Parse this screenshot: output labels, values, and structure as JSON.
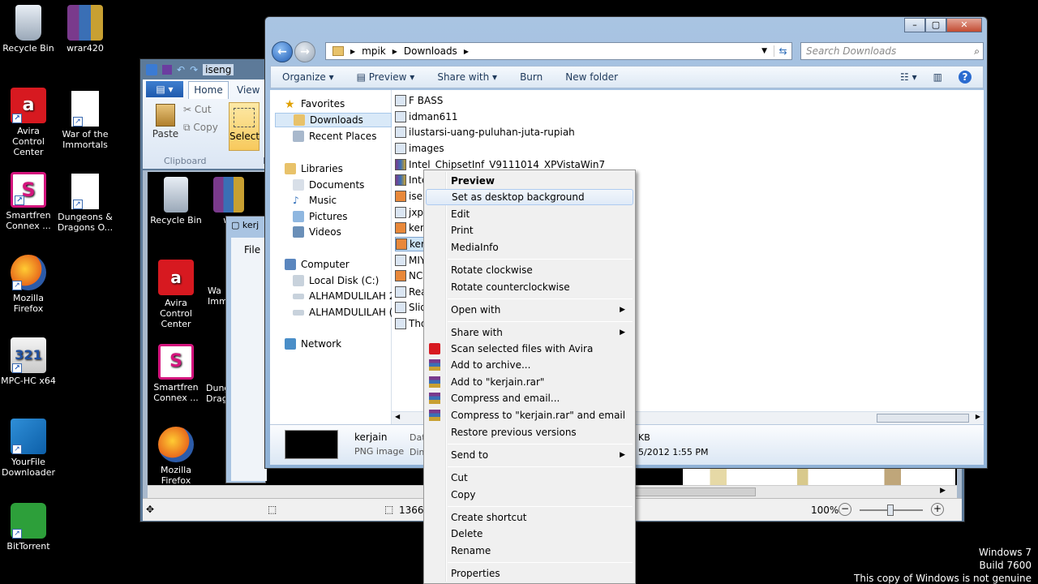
{
  "desktop": {
    "icons": [
      {
        "label": "Recycle Bin"
      },
      {
        "label": "wrar420"
      },
      {
        "label": "Avira Control Center"
      },
      {
        "label": "War of the Immortals"
      },
      {
        "label": "Smartfren Connex ..."
      },
      {
        "label": "Dungeons & Dragons O..."
      },
      {
        "label": "Mozilla Firefox"
      },
      {
        "label": "MPC-HC x64"
      },
      {
        "label": "YourFile Downloader"
      },
      {
        "label": "BitTorrent"
      }
    ],
    "watermark": {
      "line1": "Windows 7",
      "line2": "Build 7600",
      "line3": "This copy of Windows is not genuine"
    }
  },
  "paint_window": {
    "title": "iseng",
    "tabs": {
      "home": "Home",
      "view": "View"
    },
    "clipboard": {
      "paste": "Paste",
      "cut": "Cut",
      "copy": "Copy",
      "group": "Clipboard"
    },
    "select": "Select",
    "canvas_icons": {
      "recycle": "Recycle Bin",
      "wrar": "wr",
      "avira": "Avira Control Center",
      "war": "Wa Imm",
      "smartfren": "Smartfren Connex ...",
      "dungeons": "Dung Drag",
      "firefox": "Mozilla Firefox"
    },
    "inner_title": "kerj",
    "inner_file": "File",
    "status": {
      "size": "1366 ×",
      "zoom": "100%"
    }
  },
  "explorer": {
    "breadcrumb": [
      "mpik",
      "Downloads"
    ],
    "search_placeholder": "Search Downloads",
    "toolbar": {
      "organize": "Organize",
      "preview": "Preview",
      "share": "Share with",
      "burn": "Burn",
      "newfolder": "New folder"
    },
    "nav": {
      "favorites": "Favorites",
      "downloads": "Downloads",
      "recent": "Recent Places",
      "libraries": "Libraries",
      "documents": "Documents",
      "music": "Music",
      "pictures": "Pictures",
      "videos": "Videos",
      "computer": "Computer",
      "local_disk": "Local Disk (C:)",
      "drive2": "ALHAMDULILAH 2 (",
      "drive3": "ALHAMDULILAH (E:",
      "network": "Network"
    },
    "files": [
      "F BASS",
      "idman611",
      "ilustarsi-uang-puluhan-juta-rupiah",
      "images",
      "Intel_ChipsetInf_V9111014_XPVistaWin7",
      "Inte",
      "isen",
      "jxpii",
      "kerj",
      "kerja",
      "MIY",
      "NCE",
      "Real",
      "Slide",
      "Thor"
    ],
    "details": {
      "name": "kerjain",
      "type": "PNG image",
      "date_label": "Dat",
      "dim_label": "Dime",
      "size_tail": "KB",
      "date_tail": "5/2012 1:55 PM"
    }
  },
  "context_menu": {
    "preview": "Preview",
    "set_bg": "Set as desktop background",
    "edit": "Edit",
    "print": "Print",
    "mediainfo": "MediaInfo",
    "rot_cw": "Rotate clockwise",
    "rot_ccw": "Rotate counterclockwise",
    "open_with": "Open with",
    "share_with": "Share with",
    "scan": "Scan selected files with Avira",
    "add_archive": "Add to archive...",
    "add_rar": "Add to \"kerjain.rar\"",
    "compress_email": "Compress and email...",
    "compress_rar_email": "Compress to \"kerjain.rar\" and email",
    "restore": "Restore previous versions",
    "send_to": "Send to",
    "cut": "Cut",
    "copy": "Copy",
    "shortcut": "Create shortcut",
    "delete": "Delete",
    "rename": "Rename",
    "properties": "Properties"
  }
}
